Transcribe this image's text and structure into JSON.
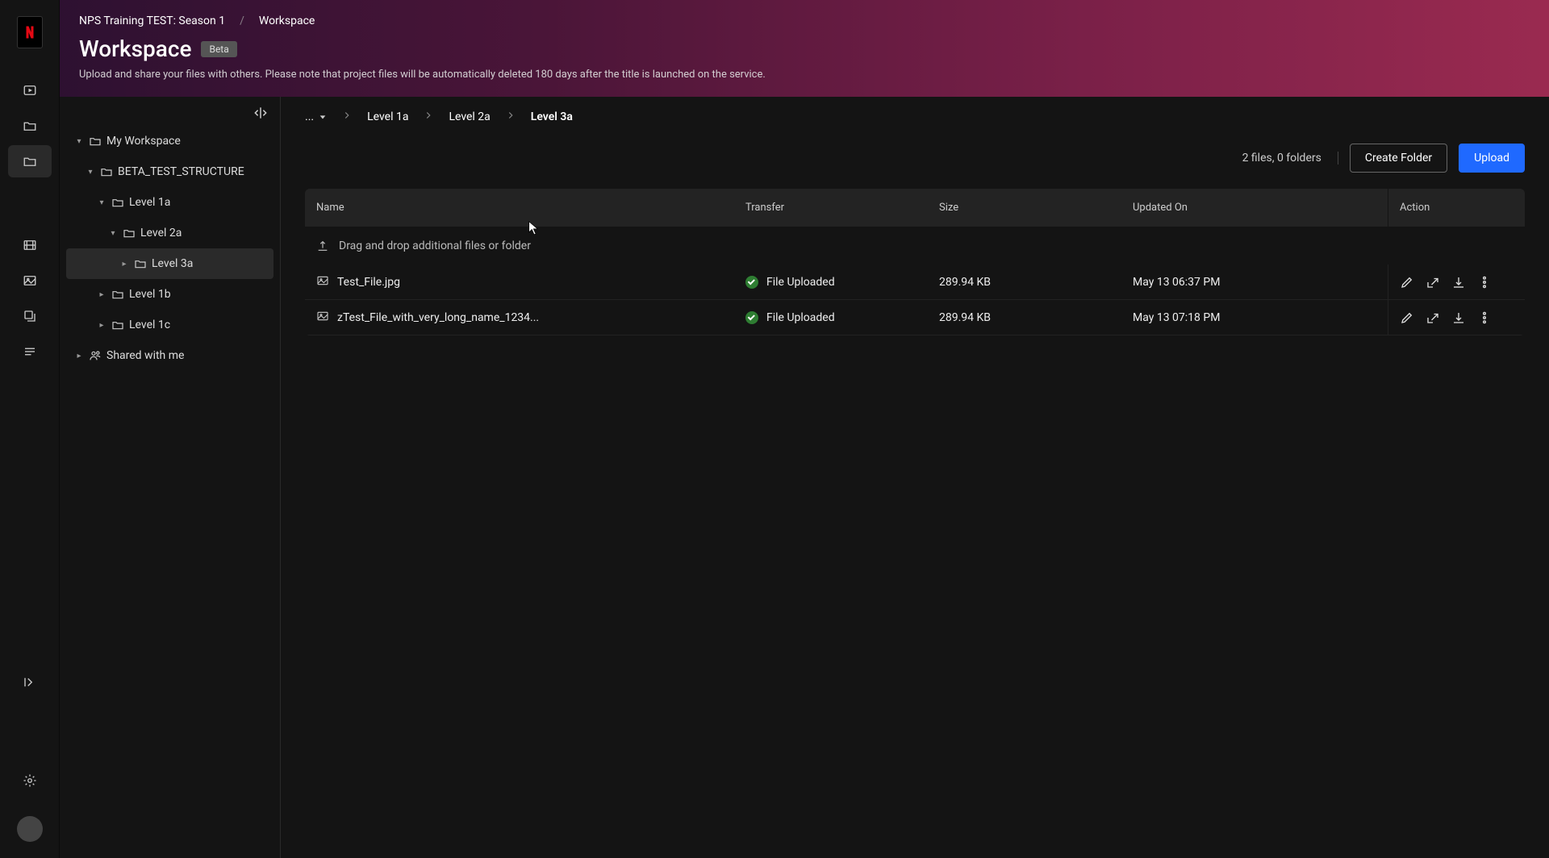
{
  "header": {
    "crumb_parent": "NPS Training TEST: Season 1",
    "crumb_current": "Workspace",
    "title": "Workspace",
    "badge": "Beta",
    "subtitle": "Upload and share your files with others. Please note that project files will be automatically deleted 180 days after the title is launched on the service."
  },
  "tree": {
    "items": [
      {
        "label": "My Workspace",
        "depth": 0,
        "caret": "down",
        "icon": "folder"
      },
      {
        "label": "BETA_TEST_STRUCTURE",
        "depth": 1,
        "caret": "down",
        "icon": "folder"
      },
      {
        "label": "Level 1a",
        "depth": 2,
        "caret": "down",
        "icon": "folder"
      },
      {
        "label": "Level 2a",
        "depth": 3,
        "caret": "down",
        "icon": "folder"
      },
      {
        "label": "Level 3a",
        "depth": 4,
        "caret": "right",
        "icon": "folder",
        "selected": true
      },
      {
        "label": "Level 1b",
        "depth": 2,
        "caret": "right",
        "icon": "folder"
      },
      {
        "label": "Level 1c",
        "depth": 2,
        "caret": "right",
        "icon": "folder"
      },
      {
        "label": "Shared with me",
        "depth": 0,
        "caret": "right",
        "icon": "shared"
      }
    ]
  },
  "breadcrumbs": {
    "more": "...",
    "items": [
      "Level 1a",
      "Level 2a"
    ],
    "current": "Level 3a"
  },
  "toolbar": {
    "stats": "2 files, 0 folders",
    "create_label": "Create Folder",
    "upload_label": "Upload"
  },
  "table": {
    "columns": [
      "Name",
      "Transfer",
      "Size",
      "Updated On",
      "Action"
    ],
    "drop_hint": "Drag and drop additional files or folder",
    "rows": [
      {
        "name": "Test_File.jpg",
        "transfer": "File Uploaded",
        "size": "289.94 KB",
        "updated": "May 13 06:37 PM"
      },
      {
        "name": "zTest_File_with_very_long_name_1234...",
        "transfer": "File Uploaded",
        "size": "289.94 KB",
        "updated": "May 13 07:18 PM"
      }
    ]
  }
}
